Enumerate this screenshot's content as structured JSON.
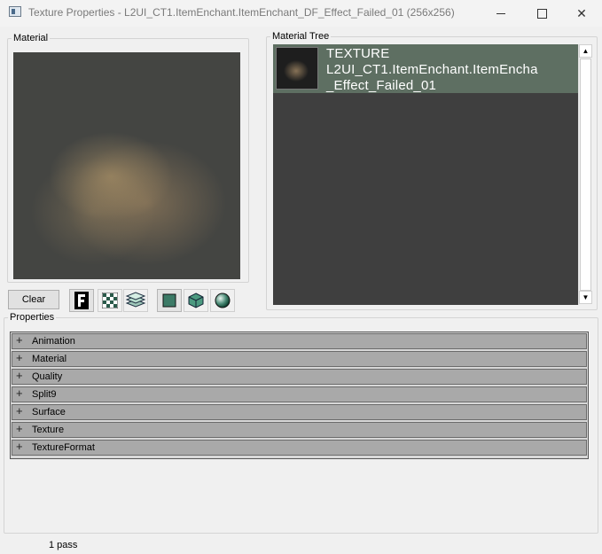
{
  "window": {
    "title": "Texture Properties - L2UI_CT1.ItemEnchant.ItemEnchant_DF_Effect_Failed_01 (256x256)",
    "minimize_label": "—",
    "close_label": "✕"
  },
  "material": {
    "group_label": "Material",
    "clear_label": "Clear"
  },
  "toolbar": {
    "icons": [
      "font-icon",
      "checker-icon",
      "layers-icon",
      "square-icon",
      "cube-icon",
      "sphere-icon"
    ]
  },
  "tree": {
    "group_label": "Material Tree",
    "item": {
      "line1": "TEXTURE",
      "line2": "L2UI_CT1.ItemEnchant.ItemEncha",
      "line3": "_Effect_Failed_01"
    },
    "scroll_up": "▲",
    "scroll_down": "▼"
  },
  "properties": {
    "group_label": "Properties",
    "expander": "+",
    "items": [
      "Animation",
      "Material",
      "Quality",
      "Split9",
      "Surface",
      "Texture",
      "TextureFormat"
    ]
  },
  "status": {
    "text": "1 pass"
  },
  "colors": {
    "preview_bg": "#444542",
    "tree_bg": "#3f3f3f",
    "tree_selected": "#5e6f62",
    "prop_row": "#a9a9a9"
  }
}
